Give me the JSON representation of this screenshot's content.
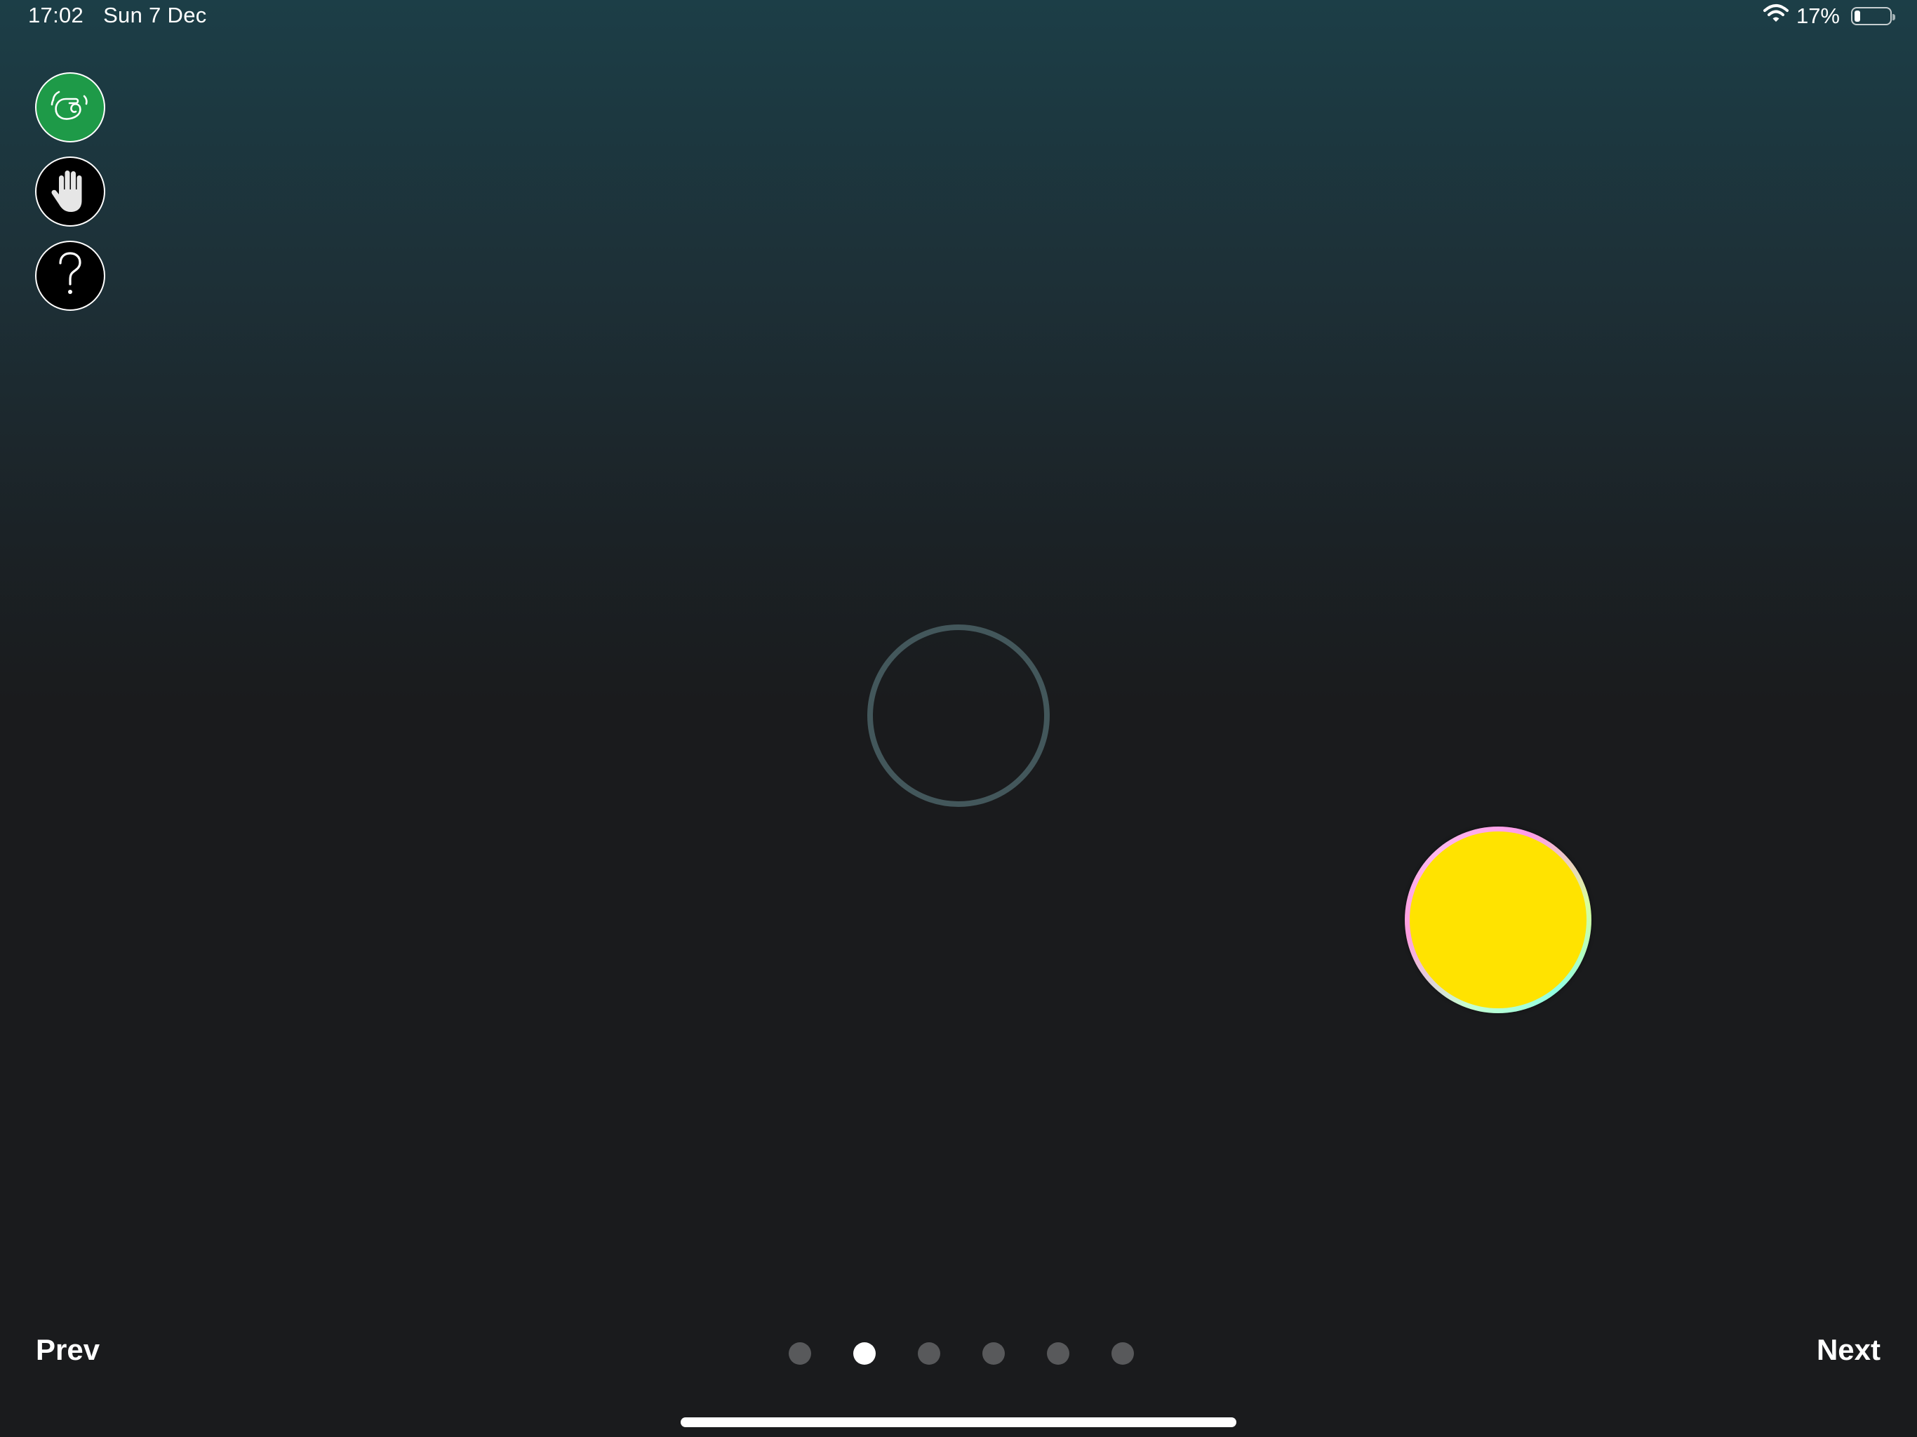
{
  "status_bar": {
    "time": "17:02",
    "date": "Sun 7 Dec",
    "battery_percent_text": "17%",
    "battery_level": 0.17,
    "wifi_icon": "wifi-icon"
  },
  "tools": [
    {
      "name": "gesture-tool",
      "icon": "hand-gesture-icon",
      "color": "#1e9a48"
    },
    {
      "name": "hand-tool",
      "icon": "hand-icon",
      "color": "#000000"
    },
    {
      "name": "help",
      "icon": "question-mark-icon",
      "color": "#000000"
    }
  ],
  "stage": {
    "target_ring_color": "#43575b",
    "ball_color": "#ffe300"
  },
  "navigation": {
    "prev_label": "Prev",
    "next_label": "Next",
    "page_count": 6,
    "current_page": 2
  }
}
